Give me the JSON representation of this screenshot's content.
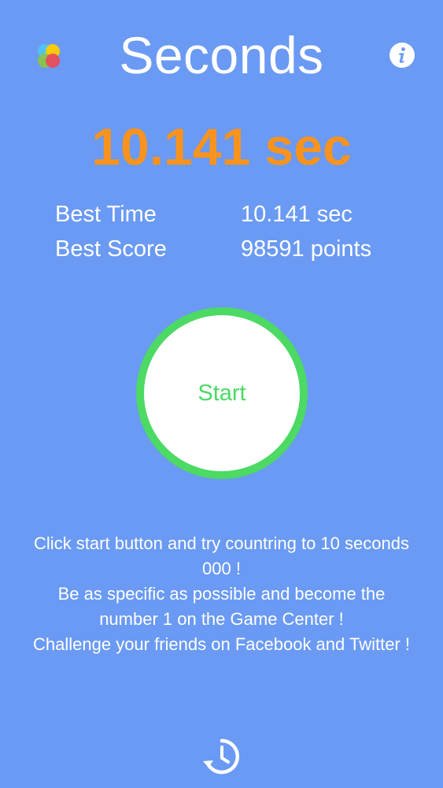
{
  "header": {
    "title": "Seconds",
    "game_center_icon": "game-center-icon",
    "info_icon": "info-icon"
  },
  "current_time": "10.141 sec",
  "stats": [
    {
      "label": "Best Time",
      "value": "10.141 sec"
    },
    {
      "label": "Best Score",
      "value": "98591 points"
    }
  ],
  "start_button": {
    "label": "Start"
  },
  "instructions": [
    "Click start button and try countring to 10 seconds 000 !",
    "Be as specific as possible and become the number 1 on the Game Center !",
    "Challenge your friends on Facebook and Twitter !"
  ],
  "footer": {
    "history_icon": "history-clock-icon"
  },
  "colors": {
    "background": "#6a9af3",
    "time_orange": "#f7931e",
    "start_green": "#4cd964",
    "text_white": "#ffffff"
  }
}
